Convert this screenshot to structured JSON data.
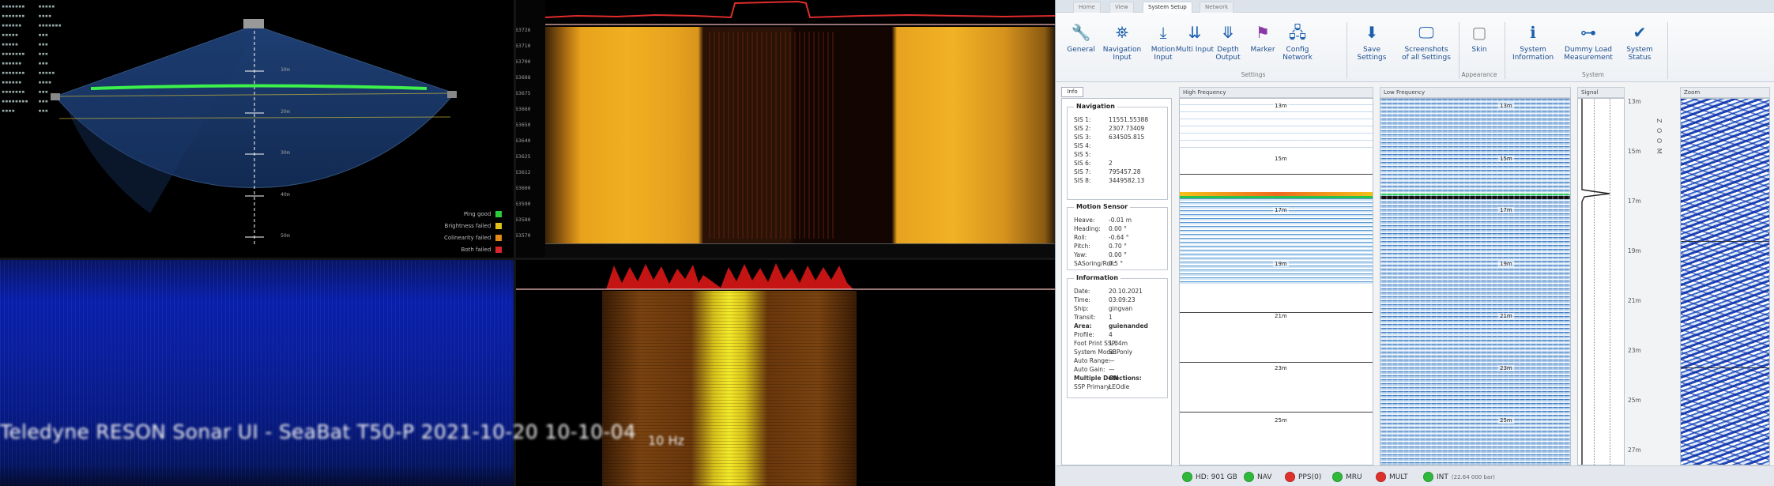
{
  "overlay": {
    "title": "Teledyne RESON Sonar UI - SeaBat T50-P 2021-10-20 10-10-04"
  },
  "sonar_fan": {
    "range_labels": [
      "10m",
      "20m",
      "30m",
      "40m",
      "50m"
    ],
    "legend": [
      {
        "label": "Ping good",
        "color": "#2ccb3a"
      },
      {
        "label": "Brightness failed",
        "color": "#e0c21a"
      },
      {
        "label": "Colinearity failed",
        "color": "#e28a1a"
      },
      {
        "label": "Both failed",
        "color": "#d8262a"
      }
    ]
  },
  "ping_rate": "10 Hz",
  "ping_counters": [
    "63726",
    "63710",
    "63700",
    "63688",
    "63675",
    "63660",
    "63650",
    "63640",
    "63625",
    "63612",
    "63600",
    "63590",
    "63580",
    "63570"
  ],
  "app": {
    "tabs": [
      "Home",
      "View",
      "System Setup",
      "Network"
    ],
    "active_tab": "System Setup",
    "ribbon": {
      "buttons": [
        {
          "label": "General",
          "icon": "wrench-icon"
        },
        {
          "label": "Navigation Input",
          "icon": "navigation-icon"
        },
        {
          "label": "Motion Input",
          "icon": "motion-icon"
        },
        {
          "label": "Multi Input",
          "icon": "multi-input-icon"
        },
        {
          "label": "Depth Output",
          "icon": "depth-icon"
        },
        {
          "label": "Marker",
          "icon": "marker-icon"
        },
        {
          "label": "Config Network",
          "icon": "network-icon"
        },
        {
          "label": "Save Settings",
          "icon": "save-icon"
        },
        {
          "label": "Screenshots of all Settings",
          "icon": "screenshot-icon"
        },
        {
          "label": "Skin",
          "icon": "skin-icon"
        },
        {
          "label": "System Information",
          "icon": "info-icon"
        },
        {
          "label": "Dummy Load Measurement",
          "icon": "dummy-load-icon"
        },
        {
          "label": "System Status",
          "icon": "checkmark-icon"
        }
      ],
      "groups": [
        "Settings",
        "Appearance",
        "System"
      ]
    },
    "info_tab": "Info",
    "navigation": {
      "title": "Navigation",
      "rows": [
        {
          "k": "SIS 1:",
          "v": "11551.55388"
        },
        {
          "k": "SIS 2:",
          "v": "2307.73409"
        },
        {
          "k": "SIS 3:",
          "v": "634505.815"
        },
        {
          "k": "SIS 4:",
          "v": ""
        },
        {
          "k": "SIS 5:",
          "v": ""
        },
        {
          "k": "SIS 6:",
          "v": "2"
        },
        {
          "k": "SIS 7:",
          "v": "795457.28"
        },
        {
          "k": "SIS 8:",
          "v": "3449582.13"
        }
      ]
    },
    "motion": {
      "title": "Motion Sensor",
      "rows": [
        {
          "k": "Heave:",
          "v": "-0.01 m"
        },
        {
          "k": "Heading:",
          "v": "0.00 °"
        },
        {
          "k": "Roll:",
          "v": "-0.64 °"
        },
        {
          "k": "Pitch:",
          "v": "0.70 °"
        },
        {
          "k": "Yaw:",
          "v": "0.00 °"
        },
        {
          "k": "SASoring/Roll:",
          "v": "0.5 °"
        }
      ]
    },
    "information": {
      "title": "Information",
      "rows": [
        {
          "k": "Date:",
          "v": "20.10.2021"
        },
        {
          "k": "Time:",
          "v": "03:09:23"
        },
        {
          "k": "Ship:",
          "v": "gingvan"
        },
        {
          "k": "Transit:",
          "v": "1"
        },
        {
          "k": "Area:",
          "v": "guienanded",
          "b": true
        },
        {
          "k": "Profile:",
          "v": "4"
        },
        {
          "k": "Foot Print SSP:",
          "v": "1.04m"
        },
        {
          "k": "System Mode:",
          "v": "SBPonly"
        },
        {
          "k": "Auto Range:",
          "v": "—"
        },
        {
          "k": "Auto Gain:",
          "v": "—"
        },
        {
          "k": "Multiple Detections:",
          "v": "ON",
          "b": true
        },
        {
          "k": "SSP Primary:",
          "v": "LEOdie"
        }
      ]
    },
    "echo_headers": {
      "high": "High Frequency",
      "low": "Low Frequency",
      "signal": "Signal",
      "zoom": "Zoom"
    },
    "depth_labels": [
      "13m",
      "15m",
      "17m",
      "19m",
      "21m",
      "23m",
      "25m"
    ],
    "zoom_label": "Z O O M",
    "zoom_ticks": [
      "13m",
      "15m",
      "17m",
      "19m",
      "21m",
      "23m",
      "25m",
      "27m"
    ],
    "status": [
      {
        "label": "HD: 901 GB",
        "color": "#2fb93b"
      },
      {
        "label": "NAV",
        "color": "#2fb93b"
      },
      {
        "label": "PPS(0)",
        "color": "#e0302c"
      },
      {
        "label": "MRU",
        "color": "#2fb93b"
      },
      {
        "label": "MULT",
        "color": "#e0302c"
      },
      {
        "label": "INT",
        "color": "#2fb93b"
      }
    ],
    "status_extra": "(22.64 000 bar)"
  }
}
